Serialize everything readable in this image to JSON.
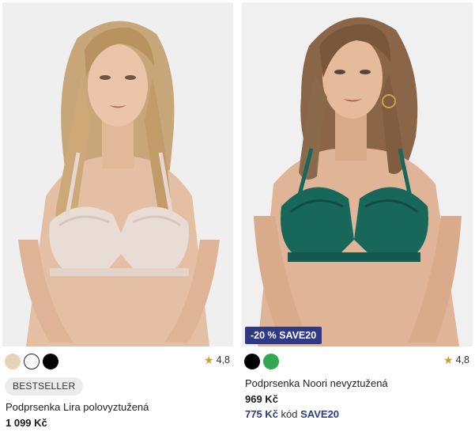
{
  "products": [
    {
      "title": "Podprsenka Lira polovyztužená",
      "price": "1 099 Kč",
      "badge": "BESTSELLER",
      "rating": "4,8",
      "swatches": [
        "#e6d3b8",
        "#ffffff",
        "#000000"
      ],
      "image": "model-beige-bra-photo"
    },
    {
      "title": "Podprsenka Noori nevyztužená",
      "price": "969 Kč",
      "promo_badge": "-20 % SAVE20",
      "sale_price": "775 Kč",
      "code_label": "kód",
      "code": "SAVE20",
      "rating": "4,8",
      "swatches": [
        "#000000",
        "#2fa84f"
      ],
      "image": "model-green-bra-photo"
    }
  ],
  "colors": {
    "promo": "#2e3a87",
    "star": "#c9a227"
  },
  "icons": {
    "rating": "star-icon"
  }
}
